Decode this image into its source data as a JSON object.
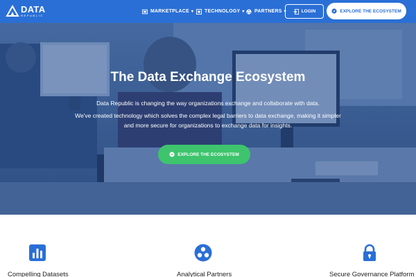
{
  "brand": {
    "word": "DATA",
    "sub": "REPUBLIC",
    "colors": {
      "primary": "#2a6fd6",
      "accent_green": "#3ec46d",
      "white": "#ffffff"
    }
  },
  "nav": {
    "items": [
      {
        "label": "MARKETPLACE",
        "icon": "storefront-icon"
      },
      {
        "label": "TECHNOLOGY",
        "icon": "chip-icon"
      },
      {
        "label": "PARTNERS",
        "icon": "partners-icon"
      }
    ],
    "login_label": "LOGIN",
    "explore_label": "EXPLORE THE ECOSYSTEM"
  },
  "hero": {
    "title": "The Data Exchange Ecosystem",
    "paragraph1": "Data Republic is changing the way organizations exchange and collaborate with data.",
    "paragraph2": "We've created technology which solves the complex legal barriers to data exchange, making it simpler and more secure for organizations to exchange data for insights.",
    "cta_label": "EXPLORE THE ECOSYSTEM"
  },
  "features": [
    {
      "label": "Compelling Datasets",
      "icon": "bar-chart-icon"
    },
    {
      "label": "Analytical Partners",
      "icon": "network-icon"
    },
    {
      "label": "Secure Governance Platform",
      "icon": "lock-icon"
    }
  ]
}
